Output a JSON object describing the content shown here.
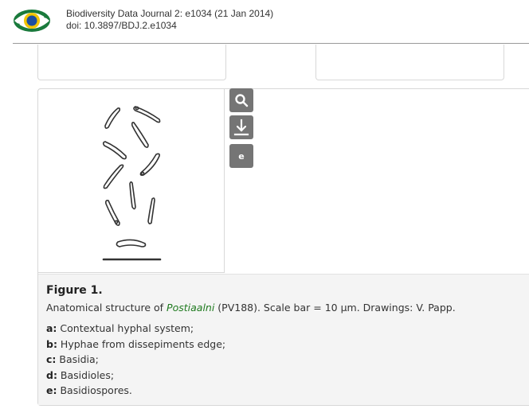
{
  "header": {
    "journal_citation": "Biodiversity Data Journal 2: e1034 (21 Jan 2014)",
    "doi": "doi: 10.3897/BDJ.2.e1034"
  },
  "toolbar": {
    "zoom_icon": "magnifier-icon",
    "download_icon": "download-arrow-icon",
    "e_label": "e"
  },
  "figure": {
    "title": "Figure 1.",
    "desc_before": "Anatomical structure of ",
    "desc_taxon": "Postiaalni",
    "desc_after": " (PV188). Scale bar = 10 µm. Drawings: V. Papp.",
    "parts": [
      {
        "key": "a:",
        "text": " Contextual hyphal system;"
      },
      {
        "key": "b:",
        "text": " Hyphae from dissepiments edge;"
      },
      {
        "key": "c:",
        "text": " Basidia;"
      },
      {
        "key": "d:",
        "text": " Basidioles;"
      },
      {
        "key": "e:",
        "text": " Basidiospores."
      }
    ]
  },
  "colors": {
    "taxon": "#1f7a1f",
    "button_bg": "#757575",
    "caption_bg": "#f4f4f4"
  }
}
